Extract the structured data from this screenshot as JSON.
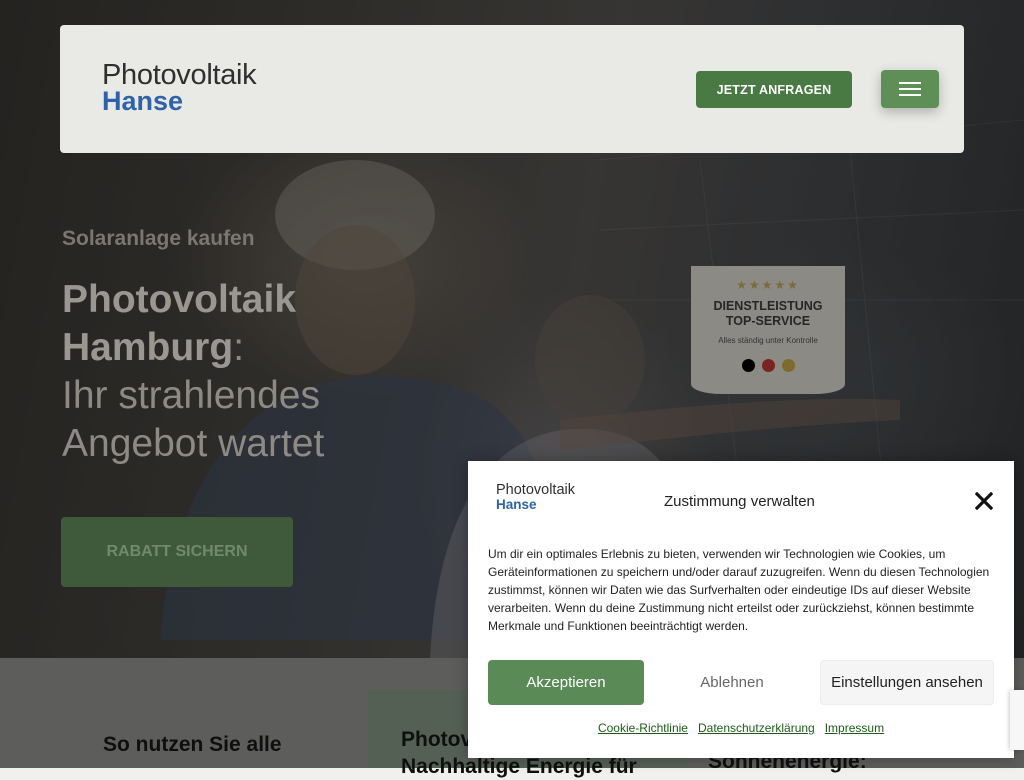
{
  "header": {
    "logo_line1": "Photovoltaik",
    "logo_line2": "Hanse",
    "cta_label": "JETZT ANFRAGEN",
    "menu_icon": "hamburger-icon"
  },
  "hero": {
    "kicker": "Solaranlage kaufen",
    "title_bold": "Photovoltaik Hamburg",
    "title_colon": ":",
    "title_light_line1": "Ihr strahlendes",
    "title_light_line2": "Angebot wartet",
    "button_label": "RABATT SICHERN"
  },
  "badge": {
    "stars": "★★★★★",
    "line1": "DIENSTLEISTUNG",
    "line2": "TOP-SERVICE",
    "subline": "Alles ständig unter Kontrolle",
    "dot_colors": [
      "#000000",
      "#b8201e",
      "#c9a227"
    ]
  },
  "below": {
    "heading1": "So nutzen Sie alle",
    "heading2_line1": "Photovo",
    "heading2_line2": "Nachhaltige Energie für",
    "heading3": "Sonnenenergie:"
  },
  "cookie_modal": {
    "logo_line1": "Photovoltaik",
    "logo_line2": "Hanse",
    "title": "Zustimmung verwalten",
    "close_icon": "close-icon",
    "text": "Um dir ein optimales Erlebnis zu bieten, verwenden wir Technologien wie Cookies, um Geräteinformationen zu speichern und/oder darauf zuzugreifen. Wenn du diesen Technologien zustimmst, können wir Daten wie das Surfverhalten oder eindeutige IDs auf dieser Website verarbeiten. Wenn du deine Zustimmung nicht erteilst oder zurückziehst, können bestimmte Merkmale und Funktionen beeinträchtigt werden.",
    "accept_label": "Akzeptieren",
    "decline_label": "Ablehnen",
    "settings_label": "Einstellungen ansehen",
    "links": [
      "Cookie-Richtlinie",
      "Datenschutzerklärung",
      "Impressum"
    ]
  },
  "colors": {
    "brand_green": "#4a7a43",
    "brand_blue": "#2f63a8"
  }
}
